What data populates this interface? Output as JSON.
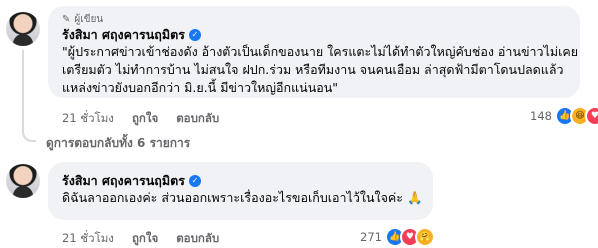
{
  "comments": [
    {
      "author_badge": "ผู้เขียน",
      "author_name": "รังสิมา ศฤงคารนฤมิตร",
      "lines": [
        "\"ผู้ประกาศข่าวเข้าช่องดัง อ้างตัวเป็นเด็กของนาย ใครแตะไม่ได้ทำตัวใหญ่คับช่อง อ่านข่าวไม่เคย",
        "เตรียมตัว ไม่ทำการบ้าน ไม่สนใจ ฝปก.ร่วม หรือทีมงาน จนคนเอือม ล่าสุดฟ้ามีตาโดนปลดแล้ว",
        "แหล่งข่าวยังบอกอีกว่า มิ.ย.นี้ มีข่าวใหญ่อีกแน่นอน\""
      ],
      "time": "21 ชั่วโมง",
      "like_label": "ถูกใจ",
      "reply_label": "ตอบกลับ",
      "reaction_count": "148",
      "reaction_icons": [
        "like-icon",
        "haha-icon",
        "love-icon"
      ]
    },
    {
      "author_name": "รังสิมา ศฤงคารนฤมิตร",
      "text": "ดิฉันลาออกเองค่ะ ส่วนออกเพราะเรื่องอะไรขอเก็บเอาไว้ในใจค่ะ 🙏",
      "time": "21 ชั่วโมง",
      "like_label": "ถูกใจ",
      "reply_label": "ตอบกลับ",
      "reaction_count": "271",
      "reaction_icons": [
        "like-icon",
        "love-icon",
        "care-icon"
      ]
    }
  ],
  "replies_link": "ดูการตอบกลับทั้ง 6 รายการ",
  "verified_symbol": "✓",
  "badge_symbol": "✎",
  "colors": {
    "bubble_bg": "#f0f2f5",
    "meta_text": "#65676b",
    "verified": "#1877f2"
  }
}
